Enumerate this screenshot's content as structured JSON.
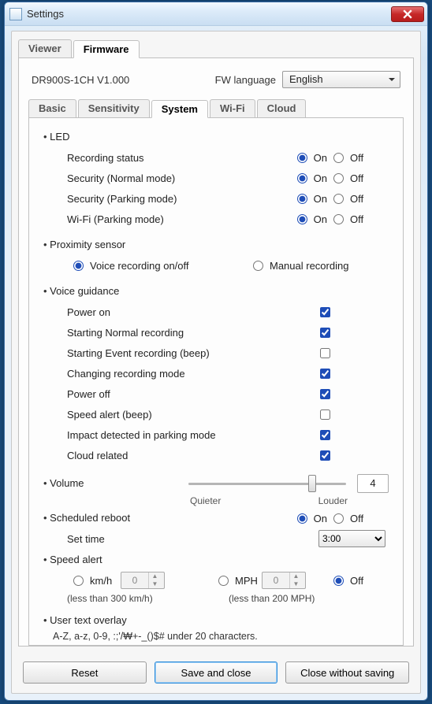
{
  "window": {
    "title": "Settings"
  },
  "outerTabs": {
    "viewer": "Viewer",
    "firmware": "Firmware"
  },
  "header": {
    "model": "DR900S-1CH   V1.000",
    "langLabel": "FW language",
    "langValue": "English"
  },
  "innerTabs": {
    "basic": "Basic",
    "sensitivity": "Sensitivity",
    "system": "System",
    "wifi": "Wi-Fi",
    "cloud": "Cloud"
  },
  "led": {
    "title": "LED",
    "items": {
      "recording": "Recording status",
      "secNormal": "Security (Normal mode)",
      "secParking": "Security (Parking mode)",
      "wifiParking": "Wi-Fi (Parking mode)"
    },
    "on": "On",
    "off": "Off"
  },
  "prox": {
    "title": "Proximity sensor",
    "voice": "Voice recording on/off",
    "manual": "Manual recording"
  },
  "voice": {
    "title": "Voice guidance",
    "items": {
      "powerOn": "Power on",
      "startNormal": "Starting Normal recording",
      "startEvent": "Starting Event recording (beep)",
      "changeMode": "Changing recording mode",
      "powerOff": "Power off",
      "speedBeep": "Speed alert (beep)",
      "impact": "Impact detected in parking mode",
      "cloud": "Cloud related"
    }
  },
  "volume": {
    "title": "Volume",
    "value": "4",
    "quieter": "Quieter",
    "louder": "Louder"
  },
  "reboot": {
    "title": "Scheduled reboot",
    "on": "On",
    "off": "Off",
    "setTime": "Set time",
    "timeValue": "3:00"
  },
  "speed": {
    "title": "Speed alert",
    "kmh": "km/h",
    "mph": "MPH",
    "off": "Off",
    "kmhVal": "0",
    "mphVal": "0",
    "kmhNote": "(less than 300 km/h)",
    "mphNote": "(less than 200 MPH)"
  },
  "overlay": {
    "title": "User text overlay",
    "hint": "A-Z, a-z, 0-9, :;'/₩+-_()$# under 20 characters.",
    "value": ""
  },
  "buttons": {
    "reset": "Reset",
    "save": "Save and close",
    "close": "Close without saving"
  }
}
